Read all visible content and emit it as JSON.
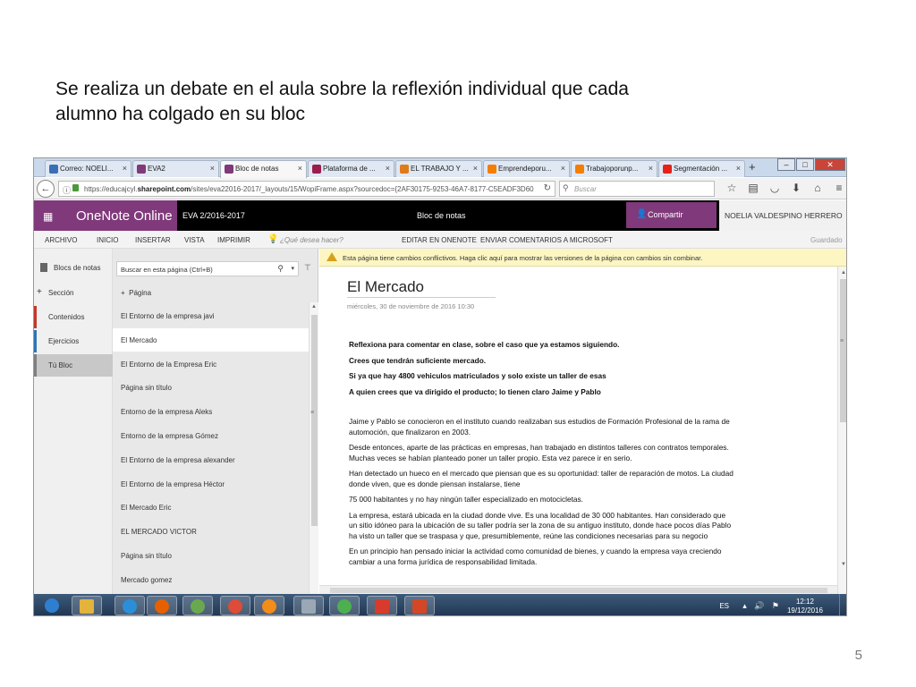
{
  "slide": {
    "title_line1": "Se realiza un debate en el aula sobre la reflexión individual que cada",
    "title_line2": "alumno ha colgado en su bloc",
    "page_number": "5"
  },
  "browser": {
    "tabs": [
      {
        "label": "Correo: NOELI...",
        "icon": "mail-icon",
        "color": "#3a6fb5"
      },
      {
        "label": "EVA2",
        "icon": "onenote-icon",
        "color": "#80397b"
      },
      {
        "label": "Bloc de notas",
        "icon": "onenote-icon",
        "color": "#80397b",
        "active": true
      },
      {
        "label": "Plataforma de ...",
        "icon": "page-icon",
        "color": "#9b1c4a"
      },
      {
        "label": "EL TRABAJO Y ...",
        "icon": "p-logo-icon",
        "color": "#e07b1a"
      },
      {
        "label": "Emprendeporu...",
        "icon": "blogger-icon",
        "color": "#f57d00"
      },
      {
        "label": "Trabajoporunp...",
        "icon": "blogger-icon",
        "color": "#f57d00"
      },
      {
        "label": "Segmentación ...",
        "icon": "youtube-icon",
        "color": "#e62117"
      }
    ],
    "url_prefix": "https://educajcyl.",
    "url_domain": "sharepoint.com",
    "url_rest": "/sites/eva22016-2017/_layouts/15/WopiFrame.aspx?sourcedoc={2AF30175-9253-46A7-8177-C5EADF3D60",
    "search_placeholder": "Buscar"
  },
  "onenote": {
    "app_name": "OneNote Online",
    "notebook": "EVA 2/2016-2017",
    "center_label": "Bloc de notas",
    "share_label": "Compartir",
    "user_name": "NOELIA VALDESPINO HERRERO",
    "ribbon": {
      "archivo": "ARCHIVO",
      "inicio": "INICIO",
      "insertar": "INSERTAR",
      "vista": "VISTA",
      "imprimir": "IMPRIMIR",
      "tell_me": "¿Qué desea hacer?",
      "edit_onenote": "EDITAR EN ONENOTE",
      "feedback": "ENVIAR COMENTARIOS A MICROSOFT",
      "saved": "Guardado"
    },
    "nav": {
      "notebooks": "Blocs de notas",
      "add_section": "Sección",
      "sections": [
        {
          "label": "Contenidos",
          "color": "#c0392b"
        },
        {
          "label": "Ejercicios",
          "color": "#2e75b6"
        },
        {
          "label": "Tú Bloc",
          "color": "#7f7f7f"
        }
      ]
    },
    "pages_panel": {
      "search_placeholder": "Buscar en esta página (Ctrl+B)",
      "add_page": "Página",
      "pages": [
        "El Entorno de la empresa javi",
        "El Mercado",
        "El Entorno de la Empresa Eric",
        "Página sin título",
        "Entorno de la empresa Aleks",
        "Entorno de la empresa Gómez",
        "El Entorno de la empresa alexander",
        "El Entorno de la empresa Héctor",
        "El Mercado Eric",
        "EL MERCADO VICTOR",
        "Página sin título",
        "Mercado gomez"
      ]
    },
    "warning": "Esta página tiene cambios conflictivos. Haga clic aquí para mostrar las versiones de la página con cambios sin combinar.",
    "page": {
      "title": "El Mercado",
      "date": "miércoles, 30 de noviembre de 2016     10:30",
      "bold_lines": [
        "Reflexiona para comentar en clase, sobre el caso que ya estamos siguiendo.",
        "Crees que tendrán suficiente mercado.",
        "Si ya que hay 4800 vehiculos matriculados y solo existe un taller de esas",
        "A quien crees que va dirigido el producto; lo tienen claro Jaime y Pablo"
      ],
      "paragraphs": [
        "Jaime y Pablo se conocieron en el instituto cuando realizaban sus estudios de Formación Profesional de la rama de automoción, que finalizaron en 2003.",
        " Desde entonces, aparte de las prácticas en empresas, han trabajado en distintos talleres con contratos   temporales. Muchas veces se habían planteado poner un taller propio. Esta vez parece ir en serio.",
        "Han detectado un hueco en el mercado que piensan que es su oportunidad: taller de reparación de       motos. La ciudad donde viven, que es donde piensan instalarse, tiene",
        "75 000 habitantes y no hay ningún    taller especializado en motocicletas.",
        "La empresa, estará ubicada en la ciudad donde vive. Es una localidad de 30 000 habitantes. Han considerado que un sitio idóneo para la ubicación de su taller podría ser la zona de su antiguo instituto, donde hace pocos días Pablo ha visto un taller que se traspasa y que, presumiblemente, reúne las    condiciones necesarias para su negocio",
        "En un principio han pensado iniciar la actividad como comunidad de bienes, y cuando la empresa vaya         creciendo cambiar a una forma jurídica de responsabilidad limitada."
      ]
    }
  },
  "taskbar": {
    "apps": [
      {
        "name": "start-orb-icon",
        "color": "#2f7fd1"
      },
      {
        "name": "explorer-folder-icon",
        "color": "#e3b43b"
      },
      {
        "name": "internet-explorer-icon",
        "color": "#2a8fd8"
      },
      {
        "name": "firefox-icon",
        "color": "#e66000"
      },
      {
        "name": "app-icon",
        "color": "#6aa84f"
      },
      {
        "name": "chrome-icon",
        "color": "#dd4b39"
      },
      {
        "name": "media-player-icon",
        "color": "#f28c1a"
      },
      {
        "name": "printer-icon",
        "color": "#9aa7b5"
      },
      {
        "name": "program-icon",
        "color": "#4caf50"
      },
      {
        "name": "pdf-icon",
        "color": "#d83b2b"
      },
      {
        "name": "powerpoint-icon",
        "color": "#d24726"
      }
    ],
    "language": "ES",
    "time": "12:12",
    "date": "19/12/2016"
  }
}
